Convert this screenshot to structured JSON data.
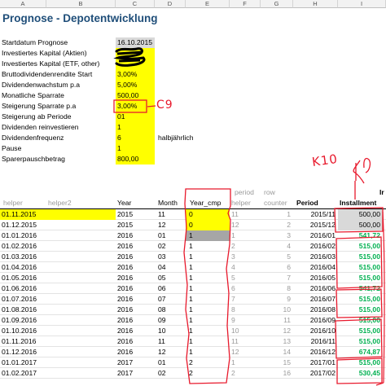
{
  "columns": [
    "A",
    "B",
    "C",
    "D",
    "E",
    "F",
    "G",
    "H",
    "I"
  ],
  "title": "Prognose - Depotentwicklung",
  "params": [
    {
      "label": "Startdatum Prognose",
      "value": "16.10.2015",
      "style": "lightgrey"
    },
    {
      "label": "Investiertes Kapital (Aktien)",
      "value": "",
      "style": "yellow"
    },
    {
      "label": "Investiertes Kapital (ETF, other)",
      "value": "",
      "style": "yellow"
    },
    {
      "label": "Bruttodividendenrendite Start",
      "value": "3,00%",
      "style": "yellow"
    },
    {
      "label": "Dividendenwachstum p.a",
      "value": "5,00%",
      "style": "yellow"
    },
    {
      "label": "Monatliche Sparrate",
      "value": "500,00",
      "style": "yellow"
    },
    {
      "label": "Steigerung Sparrate p.a",
      "value": "3,00%",
      "style": "yellow"
    },
    {
      "label": "Steigerung ab Periode",
      "value": "01",
      "style": "yellow"
    },
    {
      "label": "Dividenden reinvestieren",
      "value": "1",
      "style": "yellow"
    },
    {
      "label": "Dividendenfrequenz",
      "value": "6",
      "style": "yellow",
      "note": "halbjährlich"
    },
    {
      "label": "Pause",
      "value": "1",
      "style": "yellow"
    },
    {
      "label": "Sparerpauschbetrag",
      "value": "800,00",
      "style": "yellow"
    }
  ],
  "annotations": {
    "c9": "C9",
    "k10": "K10"
  },
  "table": {
    "header_top": {
      "period": "period",
      "row": "row",
      "right": "Ir"
    },
    "headers": [
      "helper",
      "helper2",
      "Year",
      "Month",
      "Year_cmp",
      "helper",
      "counter",
      "Period",
      "Installment"
    ],
    "rows": [
      {
        "date": "01.11.2015",
        "year": "2015",
        "month": "11",
        "cmp": "0",
        "h": "11",
        "c": "1",
        "period": "2015/11",
        "inst": "500,00"
      },
      {
        "date": "01.12.2015",
        "year": "2015",
        "month": "12",
        "cmp": "0",
        "h": "12",
        "c": "2",
        "period": "2015/12",
        "inst": "500,00"
      },
      {
        "date": "01.01.2016",
        "year": "2016",
        "month": "01",
        "cmp": "1",
        "h": "1",
        "c": "3",
        "period": "2016/01",
        "inst": "541,72"
      },
      {
        "date": "01.02.2016",
        "year": "2016",
        "month": "02",
        "cmp": "1",
        "h": "2",
        "c": "4",
        "period": "2016/02",
        "inst": "515,00"
      },
      {
        "date": "01.03.2016",
        "year": "2016",
        "month": "03",
        "cmp": "1",
        "h": "3",
        "c": "5",
        "period": "2016/03",
        "inst": "515,00"
      },
      {
        "date": "01.04.2016",
        "year": "2016",
        "month": "04",
        "cmp": "1",
        "h": "4",
        "c": "6",
        "period": "2016/04",
        "inst": "515,00"
      },
      {
        "date": "01.05.2016",
        "year": "2016",
        "month": "05",
        "cmp": "1",
        "h": "5",
        "c": "7",
        "period": "2016/05",
        "inst": "515,00"
      },
      {
        "date": "01.06.2016",
        "year": "2016",
        "month": "06",
        "cmp": "1",
        "h": "6",
        "c": "8",
        "period": "2016/06",
        "inst": "541,72"
      },
      {
        "date": "01.07.2016",
        "year": "2016",
        "month": "07",
        "cmp": "1",
        "h": "7",
        "c": "9",
        "period": "2016/07",
        "inst": "515,00"
      },
      {
        "date": "01.08.2016",
        "year": "2016",
        "month": "08",
        "cmp": "1",
        "h": "8",
        "c": "10",
        "period": "2016/08",
        "inst": "515,00"
      },
      {
        "date": "01.09.2016",
        "year": "2016",
        "month": "09",
        "cmp": "1",
        "h": "9",
        "c": "11",
        "period": "2016/09",
        "inst": "515,00"
      },
      {
        "date": "01.10.2016",
        "year": "2016",
        "month": "10",
        "cmp": "1",
        "h": "10",
        "c": "12",
        "period": "2016/10",
        "inst": "515,00"
      },
      {
        "date": "01.11.2016",
        "year": "2016",
        "month": "11",
        "cmp": "1",
        "h": "11",
        "c": "13",
        "period": "2016/11",
        "inst": "515,00"
      },
      {
        "date": "01.12.2016",
        "year": "2016",
        "month": "12",
        "cmp": "1",
        "h": "12",
        "c": "14",
        "period": "2016/12",
        "inst": "674,87"
      },
      {
        "date": "01.01.2017",
        "year": "2017",
        "month": "01",
        "cmp": "2",
        "h": "1",
        "c": "15",
        "period": "2017/01",
        "inst": "515,00"
      },
      {
        "date": "01.02.2017",
        "year": "2017",
        "month": "02",
        "cmp": "2",
        "h": "2",
        "c": "16",
        "period": "2017/02",
        "inst": "530,45"
      }
    ]
  },
  "colors": {
    "yellow": "#ffff00",
    "green": "#00b050",
    "annotation_red": "#e8192c",
    "title_blue": "#1f4e79"
  }
}
